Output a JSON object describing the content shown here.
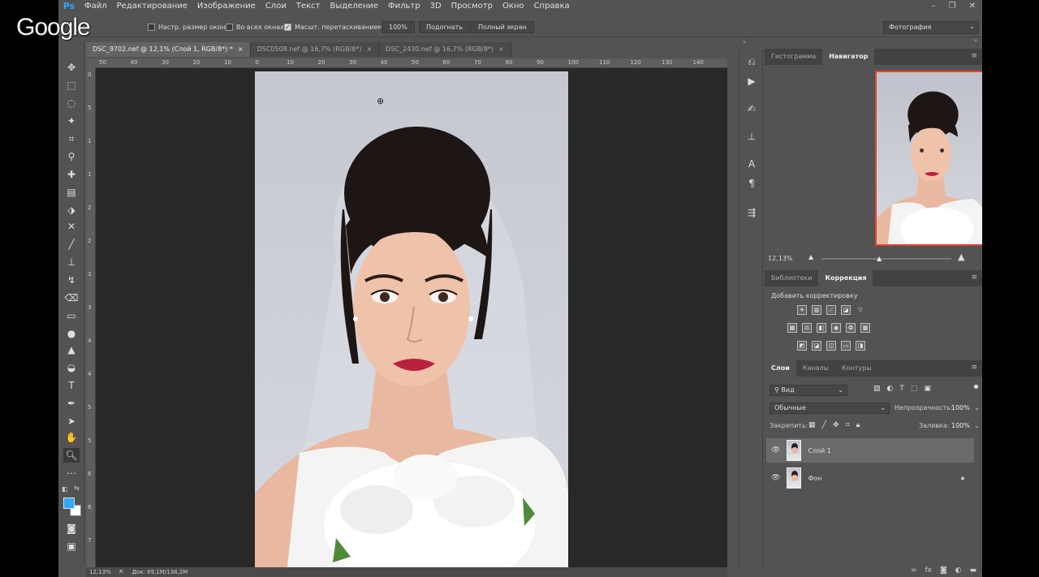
{
  "app": {
    "logo": "Ps"
  },
  "menubar": {
    "items": [
      "Файл",
      "Редактирование",
      "Изображение",
      "Слои",
      "Текст",
      "Выделение",
      "Фильтр",
      "3D",
      "Просмотр",
      "Окно",
      "Справка"
    ]
  },
  "overlay": {
    "google_watermark": "Google"
  },
  "options_bar": {
    "resize_windows": "Настр. размер окон",
    "all_windows": "Во всех окнах",
    "scrubby_zoom": "Масшт. перетаскиванием",
    "btn_100": "100%",
    "btn_fit": "Подогнать",
    "btn_fullscreen": "Полный экран",
    "workspace": "Фотография",
    "scrubby_checked": true,
    "all_windows_checked": false
  },
  "tabs": [
    {
      "label": "DSC_9702.nef @ 12,1% (Слой 1, RGB/8*) *",
      "close": "×",
      "active": true
    },
    {
      "label": "DSC0508.nef @ 16,7% (RGB/8*)",
      "close": "×",
      "active": false
    },
    {
      "label": "DSC_2430.nef @ 16,7% (RGB/8*)",
      "close": "×",
      "active": false
    }
  ],
  "ruler": {
    "h_ticks": [
      "50",
      "40",
      "30",
      "20",
      "10",
      "0",
      "10",
      "20",
      "30",
      "40",
      "50",
      "60",
      "70",
      "80",
      "90",
      "100",
      "110",
      "120",
      "130",
      "140"
    ],
    "v_ticks": [
      "0",
      "5",
      "1",
      "1",
      "2",
      "2",
      "3",
      "3",
      "4",
      "4",
      "5",
      "5",
      "6",
      "6",
      "7"
    ]
  },
  "status": {
    "zoom": "12,13%",
    "doc": "Док: 69,1M/138,2M"
  },
  "navigator": {
    "tab_histogram": "Гистограмма",
    "tab_navigator": "Навигатор",
    "zoom": "12,13%",
    "zoom_level": 0.45,
    "frame_color": "#e0442e"
  },
  "adjustments": {
    "tab_libraries": "Библиотеки",
    "tab_correction": "Коррекция",
    "heading": "Добавить корректировку"
  },
  "layers": {
    "tab_layers": "Слои",
    "tab_channels": "Каналы",
    "tab_paths": "Контуры",
    "filter_kind": "Вид",
    "blend_mode": "Обычные",
    "opacity_label": "Непрозрачность:",
    "opacity_value": "100%",
    "lock_label": "Закрепить:",
    "fill_label": "Заливка:",
    "fill_value": "100%",
    "items": [
      {
        "name": "Слой 1",
        "selected": true,
        "locked": false
      },
      {
        "name": "Фон",
        "selected": false,
        "locked": true
      }
    ]
  },
  "colors": {
    "foreground": "#31a8ff",
    "background": "#ffffff",
    "accent_ps": "#31a8ff"
  }
}
